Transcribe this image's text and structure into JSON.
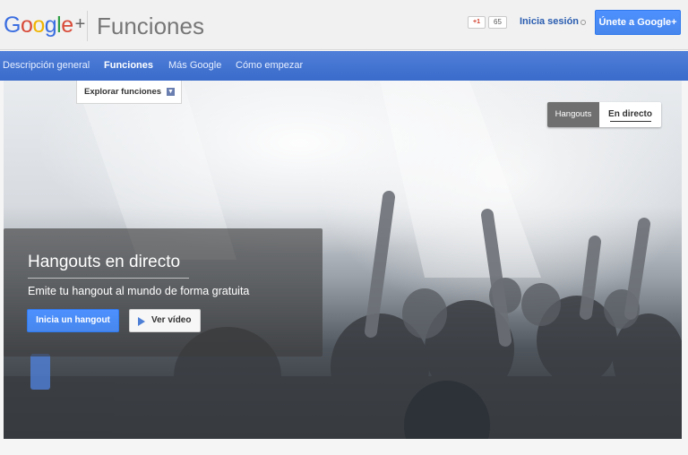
{
  "header": {
    "logo": [
      "G",
      "o",
      "o",
      "g",
      "l",
      "e",
      "+"
    ],
    "logo_colors": [
      "#3b6ee0",
      "#d84a38",
      "#f0b400",
      "#3b6ee0",
      "#2f9e44",
      "#d84a38",
      "#666666"
    ],
    "title": "Funciones",
    "plusone_label": "+1",
    "plusone_count": "65",
    "signin": "Inicia sesión",
    "join_button": "Únete a Google+"
  },
  "nav": {
    "items": [
      {
        "label": "Descripción general",
        "active": false
      },
      {
        "label": "Funciones",
        "active": true
      },
      {
        "label": "Más Google",
        "active": false
      },
      {
        "label": "Cómo empezar",
        "active": false
      }
    ]
  },
  "explore": {
    "label": "Explorar funciones",
    "icon": "chevron-down-icon"
  },
  "toggle": {
    "options": [
      "Hangouts",
      "En directo"
    ],
    "selected": "En directo"
  },
  "promo": {
    "title": "Hangouts en directo",
    "subtitle": "Emite tu hangout al mundo de forma gratuita",
    "primary_button": "Inicia un hangout",
    "video_button": "Ver vídeo"
  },
  "colors": {
    "accent": "#4d90fe",
    "nav_blue": "#3a6bcb"
  }
}
